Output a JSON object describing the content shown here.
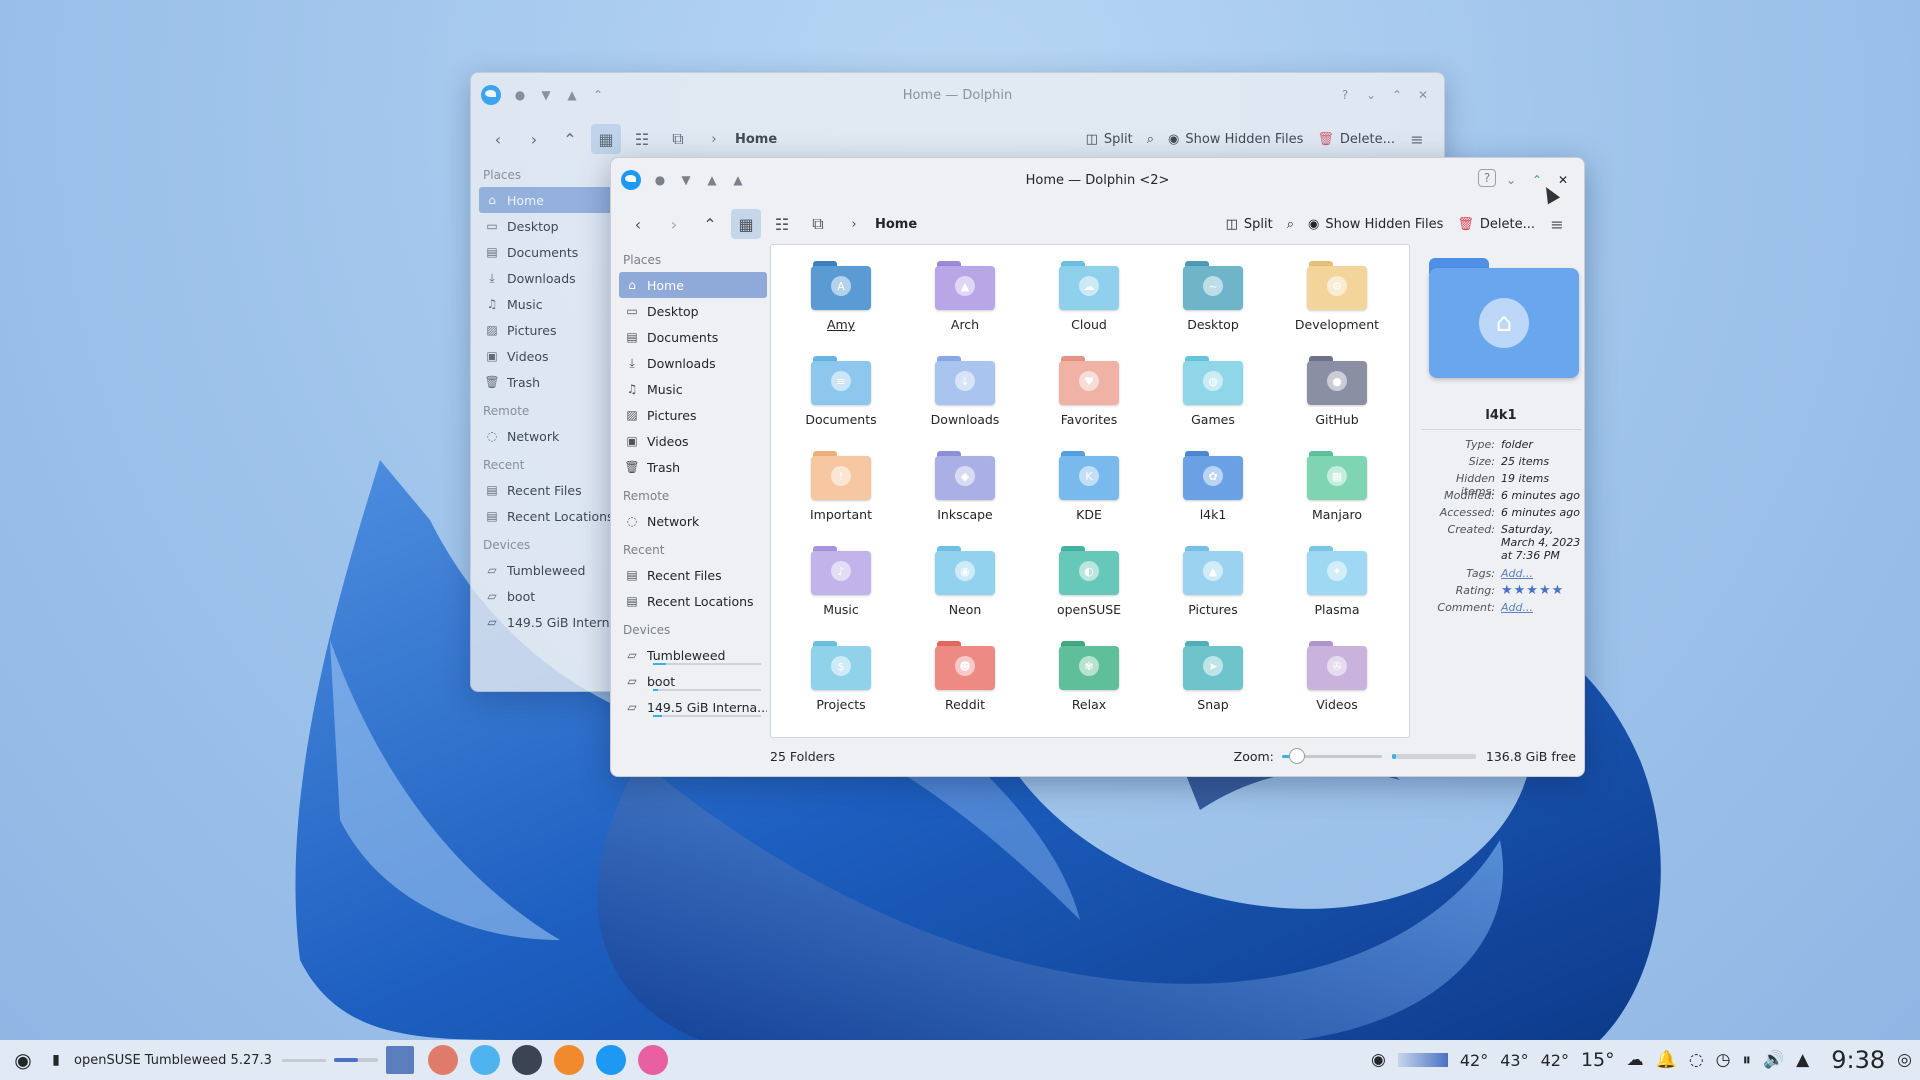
{
  "desktop": {
    "wallpaper": "blue ribbon swirl",
    "accent": "#1d99f3"
  },
  "back_window": {
    "title": "Home — Dolphin",
    "breadcrumb": "Home",
    "toolbar": {
      "split": "Split",
      "hidden": "Show Hidden Files",
      "delete": "Delete..."
    },
    "places_header": "Places",
    "places": [
      {
        "label": "Home",
        "icon": "home-icon"
      },
      {
        "label": "Desktop",
        "icon": "desktop-icon"
      },
      {
        "label": "Documents",
        "icon": "documents-icon"
      },
      {
        "label": "Downloads",
        "icon": "downloads-icon"
      },
      {
        "label": "Music",
        "icon": "music-icon"
      },
      {
        "label": "Pictures",
        "icon": "pictures-icon"
      },
      {
        "label": "Videos",
        "icon": "videos-icon"
      },
      {
        "label": "Trash",
        "icon": "trash-icon"
      }
    ],
    "remote_header": "Remote",
    "remote": [
      {
        "label": "Network"
      }
    ],
    "recent_header": "Recent",
    "recent": [
      {
        "label": "Recent Files"
      },
      {
        "label": "Recent Locations"
      }
    ],
    "devices_header": "Devices",
    "devices": [
      {
        "label": "Tumbleweed"
      },
      {
        "label": "boot"
      },
      {
        "label": "149.5 GiB Interna..."
      }
    ]
  },
  "front_window": {
    "title": "Home — Dolphin <2>",
    "breadcrumb": "Home",
    "toolbar": {
      "split": "Split",
      "hidden": "Show Hidden Files",
      "delete": "Delete..."
    },
    "places_header": "Places",
    "places": [
      {
        "label": "Home"
      },
      {
        "label": "Desktop"
      },
      {
        "label": "Documents"
      },
      {
        "label": "Downloads"
      },
      {
        "label": "Music"
      },
      {
        "label": "Pictures"
      },
      {
        "label": "Videos"
      },
      {
        "label": "Trash"
      }
    ],
    "remote_header": "Remote",
    "remote": [
      {
        "label": "Network"
      }
    ],
    "recent_header": "Recent",
    "recent": [
      {
        "label": "Recent Files"
      },
      {
        "label": "Recent Locations"
      }
    ],
    "devices_header": "Devices",
    "devices": [
      {
        "label": "Tumbleweed",
        "usage": 0.12
      },
      {
        "label": "boot",
        "usage": 0.05
      },
      {
        "label": "149.5 GiB Interna...",
        "usage": 0.08
      }
    ],
    "folders": [
      {
        "name": "Amy",
        "color": "#5a9bd4",
        "tab": "#3f7fbf",
        "glyph": "A"
      },
      {
        "name": "Arch",
        "color": "#b9a6e6",
        "tab": "#9d87d6",
        "glyph": "▲"
      },
      {
        "name": "Cloud",
        "color": "#8fd0ec",
        "tab": "#6bbfe2",
        "glyph": "☁"
      },
      {
        "name": "Desktop",
        "color": "#6fb5c9",
        "tab": "#4f9bb1",
        "glyph": "~"
      },
      {
        "name": "Development",
        "color": "#f3d49a",
        "tab": "#e6bf78",
        "glyph": "⚙"
      },
      {
        "name": "Documents",
        "color": "#8ec7ee",
        "tab": "#69b2e4",
        "glyph": "≡"
      },
      {
        "name": "Downloads",
        "color": "#a8c4ef",
        "tab": "#86a9e3",
        "glyph": "↓"
      },
      {
        "name": "Favorites",
        "color": "#f0b2a4",
        "tab": "#e69482",
        "glyph": "♥"
      },
      {
        "name": "Games",
        "color": "#8ed6e8",
        "tab": "#67c4da",
        "glyph": "◍"
      },
      {
        "name": "GitHub",
        "color": "#8a8fa4",
        "tab": "#6d7289",
        "glyph": "●"
      },
      {
        "name": "Important",
        "color": "#f6c7a0",
        "tab": "#eeaf7c",
        "glyph": "!"
      },
      {
        "name": "Inkscape",
        "color": "#aab0e6",
        "tab": "#8c92d6",
        "glyph": "◆"
      },
      {
        "name": "KDE",
        "color": "#78b9ee",
        "tab": "#549fe2",
        "glyph": "K"
      },
      {
        "name": "l4k1",
        "color": "#6aa0e4",
        "tab": "#4c86d4",
        "glyph": "✿"
      },
      {
        "name": "Manjaro",
        "color": "#7fd4b2",
        "tab": "#5cc29a",
        "glyph": "▦"
      },
      {
        "name": "Music",
        "color": "#c2b3ea",
        "tab": "#a694dc",
        "glyph": "♪"
      },
      {
        "name": "Neon",
        "color": "#92d2ee",
        "tab": "#6ec0e4",
        "glyph": "◉"
      },
      {
        "name": "openSUSE",
        "color": "#66c8b8",
        "tab": "#45b1a0",
        "glyph": "◐"
      },
      {
        "name": "Pictures",
        "color": "#9ad2f0",
        "tab": "#76bfe6",
        "glyph": "▲"
      },
      {
        "name": "Plasma",
        "color": "#9ed8f2",
        "tab": "#7ac6e8",
        "glyph": "✦"
      },
      {
        "name": "Projects",
        "color": "#8fd2ea",
        "tab": "#6ac0de",
        "glyph": "$"
      },
      {
        "name": "Reddit",
        "color": "#ee8a84",
        "tab": "#e2665e",
        "glyph": "☻"
      },
      {
        "name": "Relax",
        "color": "#5fbf9a",
        "tab": "#42a880",
        "glyph": "✾"
      },
      {
        "name": "Snap",
        "color": "#6fc4cc",
        "tab": "#4fb0b9",
        "glyph": "➤"
      },
      {
        "name": "Videos",
        "color": "#c9b2dc",
        "tab": "#b095cc",
        "glyph": "✇"
      }
    ],
    "info": {
      "name": "l4k1",
      "type_k": "Type:",
      "type": "folder",
      "size_k": "Size:",
      "size": "25 items",
      "hidden_k": "Hidden items:",
      "hidden": "19 items",
      "modified_k": "Modified:",
      "modified": "6 minutes ago",
      "accessed_k": "Accessed:",
      "accessed": "6 minutes ago",
      "created_k": "Created:",
      "created": "Saturday, March 4, 2023 at 7:36 PM",
      "tags_k": "Tags:",
      "tags": "Add...",
      "rating_k": "Rating:",
      "rating": 5,
      "rating_stars": "★★★★★",
      "comment_k": "Comment:",
      "comment": "Add..."
    },
    "status": {
      "count": "25 Folders",
      "zoom_label": "Zoom:",
      "zoom": 0.15,
      "free_fraction": 0.05,
      "free": "136.8 GiB free"
    }
  },
  "taskbar": {
    "window_title": "openSUSE Tumbleweed 5.27.3",
    "temps": [
      "42°",
      "43°",
      "42°"
    ],
    "weather": "15°",
    "clock": "9:38"
  }
}
